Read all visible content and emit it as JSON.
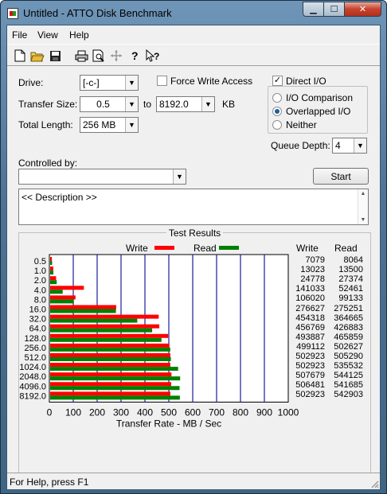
{
  "window": {
    "title": "Untitled - ATTO Disk Benchmark"
  },
  "menu": [
    "File",
    "View",
    "Help"
  ],
  "toolbar": [
    "new-icon",
    "open-icon",
    "save-icon",
    "print-icon",
    "print-preview-icon",
    "move-icon",
    "help-icon",
    "context-help-icon"
  ],
  "form": {
    "drive_label": "Drive:",
    "drive_value": "[-c-]",
    "force_write_label": "Force Write Access",
    "force_write_checked": false,
    "direct_io_label": "Direct I/O",
    "direct_io_checked": true,
    "transfer_size_label": "Transfer Size:",
    "transfer_from": "0.5",
    "to_label": "to",
    "transfer_to": "8192.0",
    "kb_label": "KB",
    "total_length_label": "Total Length:",
    "total_length_value": "256 MB",
    "io_options": [
      {
        "label": "I/O Comparison",
        "selected": false
      },
      {
        "label": "Overlapped I/O",
        "selected": true
      },
      {
        "label": "Neither",
        "selected": false
      }
    ],
    "queue_depth_label": "Queue Depth:",
    "queue_depth_value": "4",
    "controlled_by_label": "Controlled by:",
    "controlled_by_value": "",
    "start_label": "Start",
    "description": "<< Description >>"
  },
  "results": {
    "title": "Test Results",
    "write_legend": "Write",
    "read_legend": "Read",
    "write_col": "Write",
    "read_col": "Read",
    "xlabel": "Transfer Rate - MB / Sec",
    "write_color": "#ff0000",
    "read_color": "#008000"
  },
  "chart_data": {
    "type": "bar",
    "orientation": "horizontal",
    "categories": [
      "0.5",
      "1.0",
      "2.0",
      "4.0",
      "8.0",
      "16.0",
      "32.0",
      "64.0",
      "128.0",
      "256.0",
      "512.0",
      "1024.0",
      "2048.0",
      "4096.0",
      "8192.0"
    ],
    "series": [
      {
        "name": "Write",
        "values": [
          7079,
          13023,
          24778,
          141033,
          106020,
          276627,
          454318,
          456769,
          493887,
          499112,
          502923,
          502923,
          507679,
          506481,
          502923
        ]
      },
      {
        "name": "Read",
        "values": [
          8064,
          13500,
          27374,
          52461,
          99133,
          275251,
          364665,
          426883,
          465859,
          502627,
          505290,
          535532,
          544125,
          541685,
          542903
        ]
      }
    ],
    "x_ticks": [
      "0",
      "100",
      "200",
      "300",
      "400",
      "500",
      "600",
      "700",
      "800",
      "900",
      "1000"
    ],
    "xlim": [
      0,
      1000
    ],
    "xlabel": "Transfer Rate - MB / Sec",
    "value_units": "KB/s"
  },
  "status": {
    "text": "For Help, press F1"
  }
}
